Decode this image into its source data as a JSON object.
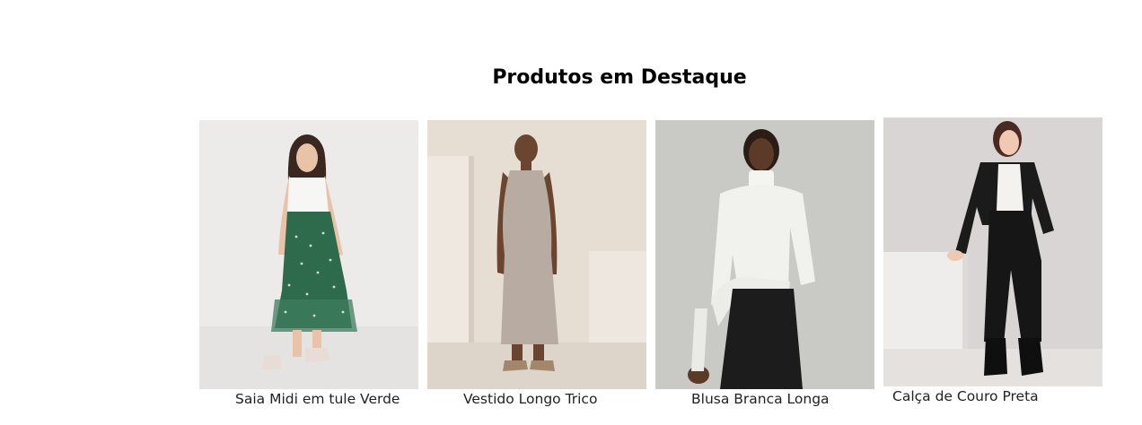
{
  "section": {
    "title": "Produtos em Destaque"
  },
  "products": [
    {
      "name": "Saia Midi em tule Verde",
      "image": "green-tulle-midi-skirt-photo"
    },
    {
      "name": "Vestido Longo Trico",
      "image": "knit-long-dress-photo"
    },
    {
      "name": "Blusa Branca Longa",
      "image": "white-turtleneck-blouse-photo"
    },
    {
      "name": "Calça de Couro Preta",
      "image": "black-leather-pants-photo"
    }
  ],
  "colors": {
    "title": "#000000",
    "caption": "#222222",
    "background": "#ffffff"
  }
}
